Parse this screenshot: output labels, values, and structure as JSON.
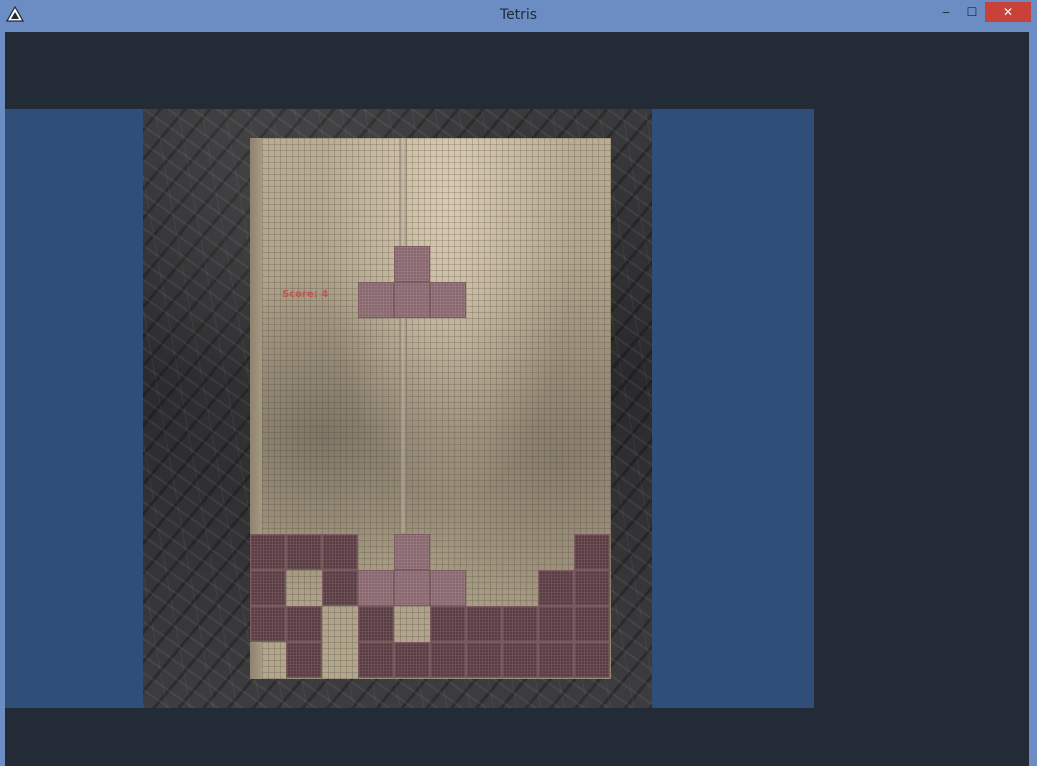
{
  "window": {
    "title": "Tetris",
    "minimize_glyph": "‒",
    "maximize_glyph": "☐",
    "close_glyph": "✕"
  },
  "game": {
    "score_text": "Score: 4",
    "colors": {
      "block": "#5a3e44",
      "block_lit": "#8a6870",
      "board": "#b3a78c",
      "viewport": "#2f4f7a",
      "background": "#222b36"
    },
    "grid": {
      "columns": 10,
      "rows": 15
    },
    "active_piece": [
      [
        4,
        3
      ],
      [
        3,
        4
      ],
      [
        4,
        4
      ],
      [
        5,
        4
      ]
    ],
    "stack": [
      [
        0,
        11
      ],
      [
        1,
        11
      ],
      [
        2,
        11
      ],
      [
        4,
        11
      ],
      [
        9,
        11
      ],
      [
        0,
        12
      ],
      [
        2,
        12
      ],
      [
        3,
        12
      ],
      [
        4,
        12
      ],
      [
        5,
        12
      ],
      [
        8,
        12
      ],
      [
        9,
        12
      ],
      [
        0,
        13
      ],
      [
        1,
        13
      ],
      [
        3,
        13
      ],
      [
        5,
        13
      ],
      [
        6,
        13
      ],
      [
        7,
        13
      ],
      [
        8,
        13
      ],
      [
        9,
        13
      ],
      [
        1,
        14
      ],
      [
        3,
        14
      ],
      [
        4,
        14
      ],
      [
        5,
        14
      ],
      [
        6,
        14
      ],
      [
        7,
        14
      ],
      [
        8,
        14
      ],
      [
        9,
        14
      ]
    ]
  }
}
